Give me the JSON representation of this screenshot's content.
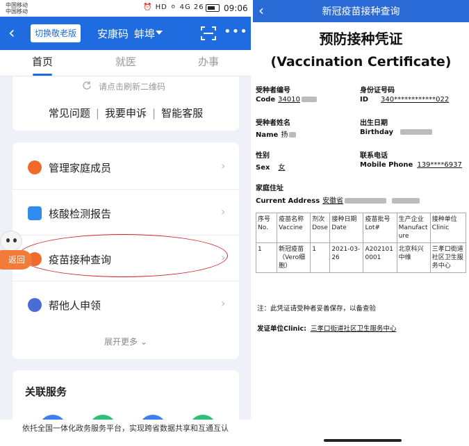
{
  "left": {
    "status": {
      "carrier1": "中国移动",
      "carrier2": "中国移动",
      "icons": "⏰ HD ⚪ 4G 26",
      "time": "09:06"
    },
    "appbar": {
      "elder_mode": "切换敬老版",
      "title": "安康码",
      "city": "蚌埠"
    },
    "tabs": [
      "首页",
      "就医",
      "办事"
    ],
    "refresh_text": "请点击刷新二维码",
    "links": [
      "常见问题",
      "我要申诉",
      "智能客服"
    ],
    "menu": [
      {
        "label": "管理家庭成员",
        "color": "#f06a2c"
      },
      {
        "label": "核酸检测报告",
        "color": "#2f8cf0"
      },
      {
        "label": "疫苗接种查询",
        "color": "#f06a2c"
      },
      {
        "label": "帮他人申领",
        "color": "#4b6bd6"
      }
    ],
    "expand": "展开更多",
    "back_fab": "返回",
    "related_title": "关联服务",
    "footer": "依托全国一体化政务服务平台，实现跨省数据共享和互通互认"
  },
  "right": {
    "bar_title": "新冠疫苗接种查询",
    "cert_title": "预防接种凭证",
    "cert_subtitle": "(Vaccination Certificate)",
    "fields": {
      "code_cn": "受种者编号",
      "code_en": "Code",
      "code_val": "34010",
      "id_cn": "身份证号码",
      "id_en": "ID",
      "id_val": "340************022",
      "name_cn": "受种者姓名",
      "name_en": "Name",
      "name_val": "扬",
      "birth_cn": "出生日期",
      "birth_en": "Birthday",
      "sex_cn": "性别",
      "sex_en": "Sex",
      "sex_val": "女",
      "phone_cn": "联系电话",
      "phone_en": "Mobile Phone",
      "phone_val": "139****6937",
      "addr_cn": "家庭住址",
      "addr_en": "Current Address",
      "addr_val": "安徽省"
    },
    "table": {
      "headers": [
        [
          "序号",
          "No."
        ],
        [
          "疫苗名称",
          "Vaccine"
        ],
        [
          "剂次",
          "Dose"
        ],
        [
          "接种日期",
          "Date"
        ],
        [
          "疫苗批号",
          "Lot#"
        ],
        [
          "生产企业",
          "Manufacture"
        ],
        [
          "接种单位",
          "Clinic"
        ]
      ],
      "rows": [
        [
          "1",
          "新冠疫苗（Vero细胞）",
          "1",
          "2021-03-26",
          "A2021010001",
          "北京科兴中维",
          "三孝口街道社区卫生服务中心"
        ]
      ]
    },
    "note": "注：此凭证请受种者妥善保存，以备查验",
    "issuer_label": "发证单位Clinic:",
    "issuer_value": "三孝口街道社区卫生服务中心"
  },
  "colors": {
    "primary": "#1f6be0",
    "header_right": "#2a6ad6",
    "highlight": "#d4232a",
    "fab": "#f27b3a"
  }
}
